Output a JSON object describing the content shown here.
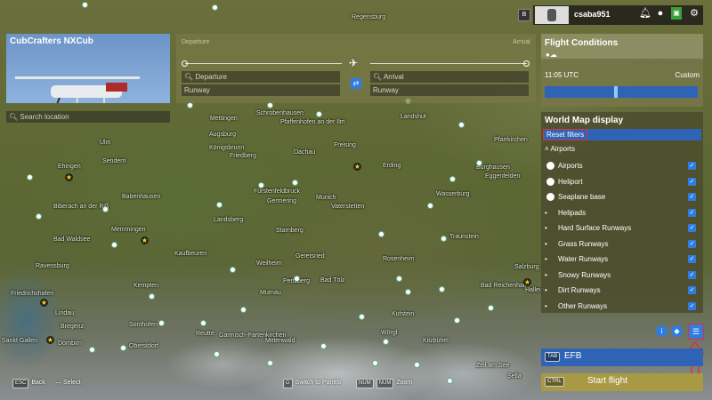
{
  "map_labels": [
    "Regensburg",
    "Ulm",
    "Ehingen",
    "Biberach an der Riß",
    "Bad Waldsee",
    "Ravensburg",
    "Friedrichshafen",
    "Lindau",
    "Bregenz",
    "Dornbirn",
    "Sankt Gallen",
    "Memmingen",
    "Kaufbeuren",
    "Kempten",
    "Sonthofen",
    "Oberstdorf",
    "Augsburg",
    "Königsbrunn",
    "Friedberg",
    "Schrobenhausen",
    "Pfaffenhofen an der Ilm",
    "Landshut",
    "Freising",
    "Dachau",
    "Fürstenfeldbruck",
    "Germering",
    "Munich",
    "Vaterstetten",
    "Starnberg",
    "Landsberg",
    "Weilheim",
    "Geretsried",
    "Bad Tölz",
    "Penzberg",
    "Murnau",
    "Garmisch-Partenkirchen",
    "Mittenwald",
    "Reutte",
    "Kufstein",
    "Rosenheim",
    "Wörgl",
    "Kitzbühel",
    "Wasserburg",
    "Traunstein",
    "Salzburg",
    "Bad Reichenhall",
    "Hallein",
    "Erding",
    "Pfarrkirchen",
    "Burghausen",
    "Eggenfelden",
    "Mettingen",
    "Sendern",
    "Babenhausen",
    "Zell am See",
    "Sella"
  ],
  "aircraft": {
    "title": "CubCrafters NXCub"
  },
  "route": {
    "departure_label": "Departure",
    "arrival_label": "Arrival",
    "departure_placeholder": "Departure",
    "arrival_placeholder": "Arrival",
    "departure_runway": "Runway",
    "arrival_runway": "Runway"
  },
  "search": {
    "placeholder": "Search location"
  },
  "user": {
    "name": "csaba951",
    "badge": "B"
  },
  "flight_conditions": {
    "title": "Flight Conditions",
    "time": "11:05 UTC",
    "mode": "Custom",
    "slider_value": 0.4
  },
  "world_map": {
    "title": "World Map display",
    "reset_label": "Reset filters",
    "section": "Airports",
    "items": [
      "Airports",
      "Heliport",
      "Seaplane base",
      "Helipads",
      "Hard Surface Runways",
      "Grass Runways",
      "Water Runways",
      "Snowy Runways",
      "Dirt Runways",
      "Other Runways"
    ]
  },
  "efb": {
    "key": "TAB",
    "label": "EFB"
  },
  "start": {
    "key": "CTRL",
    "label": "Start flight"
  },
  "hints": {
    "esc_key": "ESC",
    "back": "Back",
    "select": "Select",
    "g_key": "G",
    "switch": "Switch to Panels",
    "num_key1": "NUM",
    "num_key2": "NUM",
    "zoom": "Zoom"
  },
  "colors": {
    "accent": "#2f7de1",
    "reset_border": "#e0303a",
    "start_bg": "#a89a45"
  }
}
